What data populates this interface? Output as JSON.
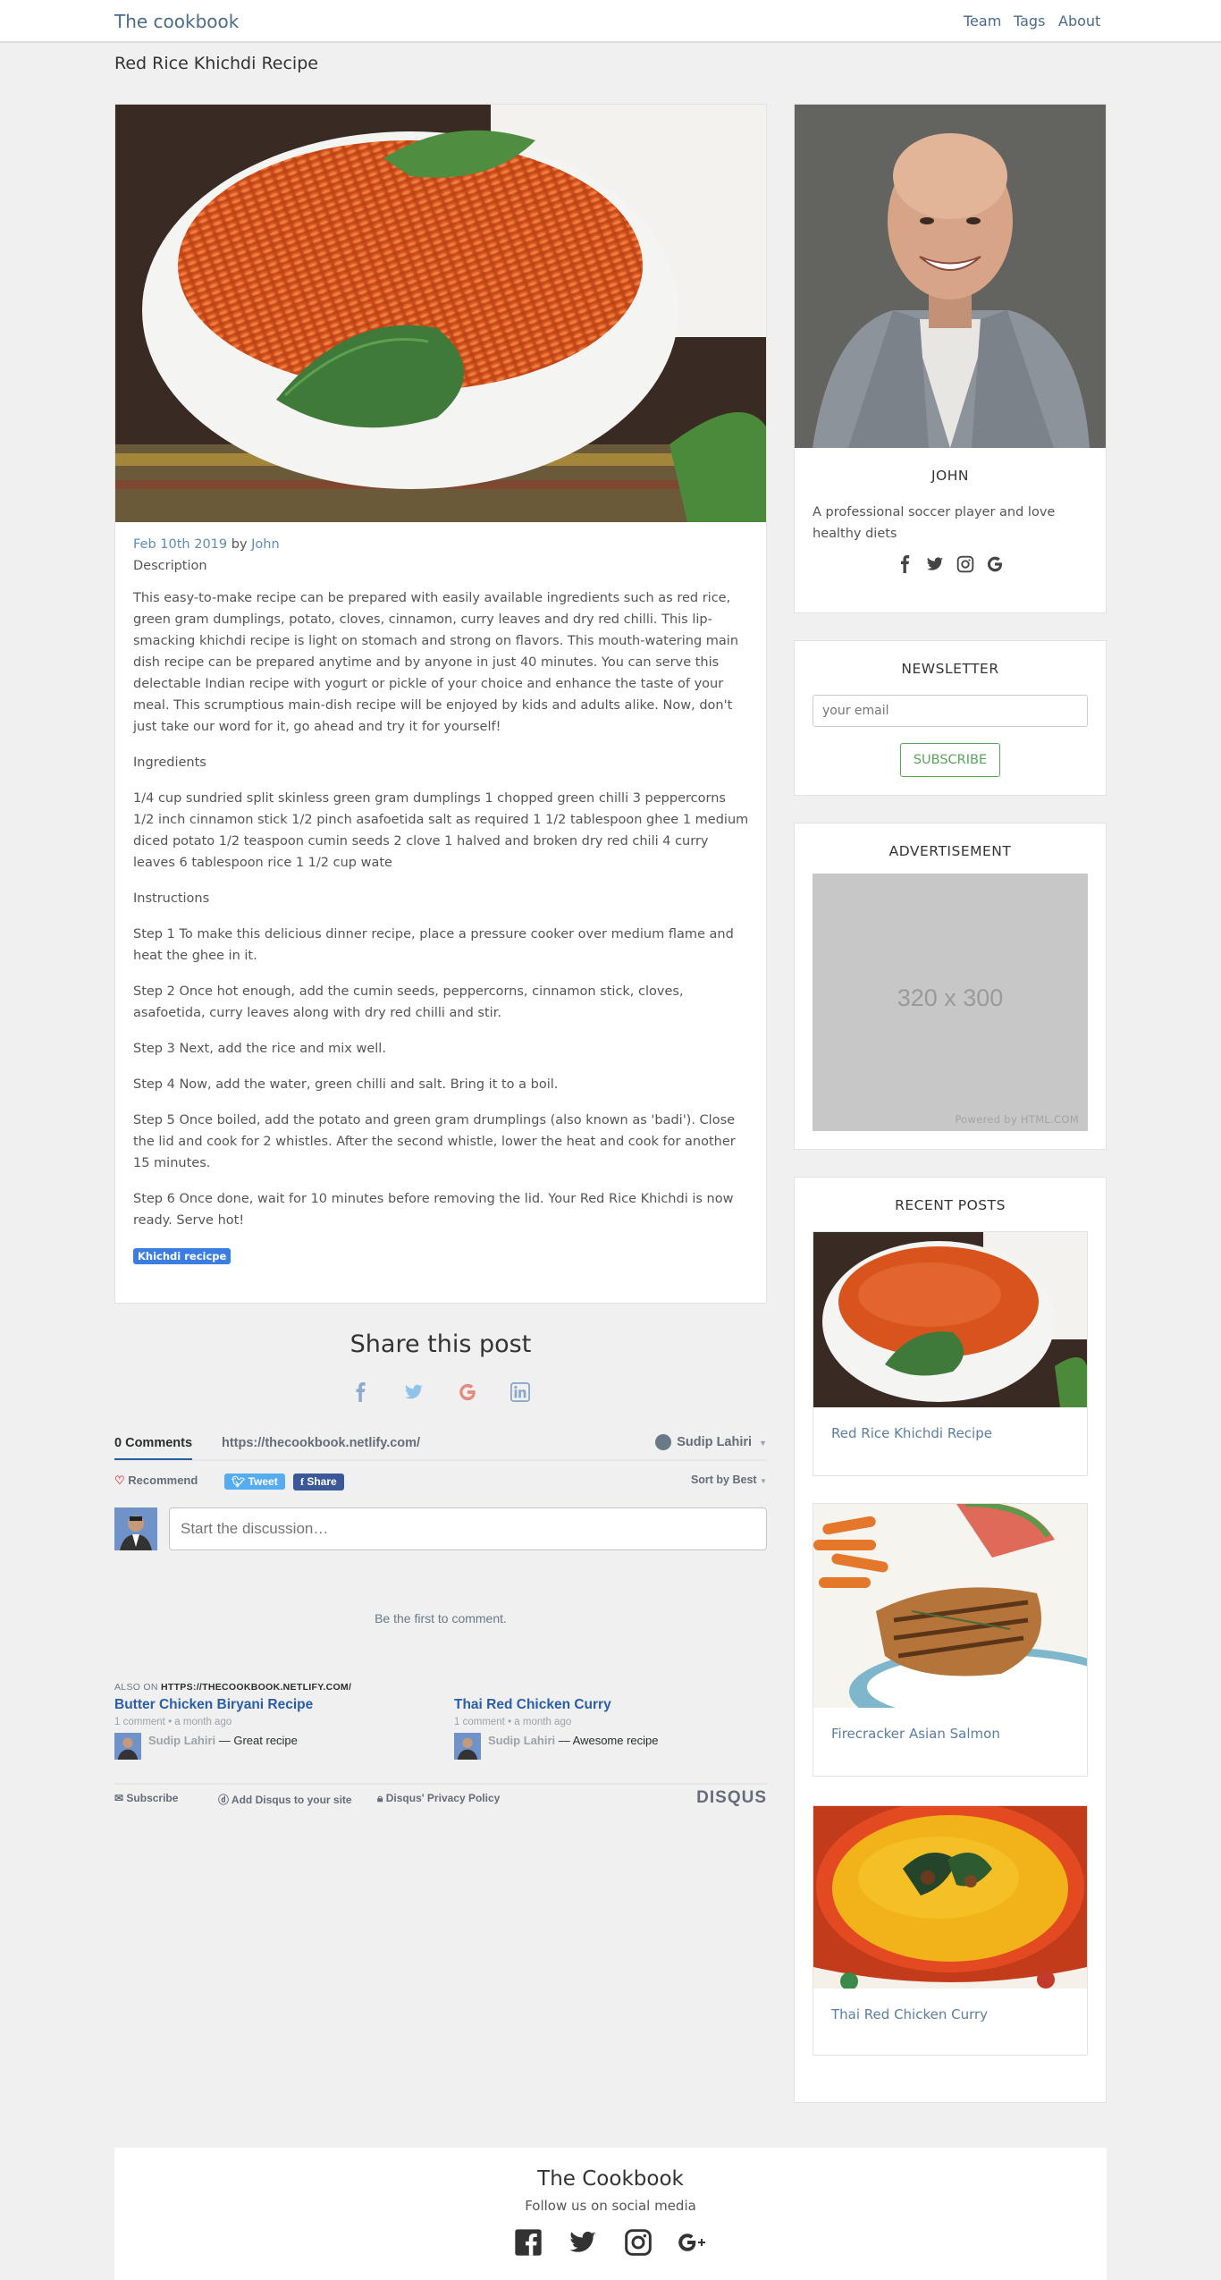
{
  "nav": {
    "brand": "The cookbook",
    "links": [
      "Team",
      "Tags",
      "About"
    ]
  },
  "page": {
    "title": "Red Rice Khichdi Recipe"
  },
  "post": {
    "date": "Feb 10th 2019",
    "by": "by",
    "author": "John",
    "description_label": "Description",
    "description": "This easy-to-make recipe can be prepared with easily available ingredients such as red rice, green gram dumplings, potato, cloves, cinnamon, curry leaves and dry red chilli. This lip-smacking khichdi recipe is light on stomach and strong on flavors. This mouth-watering main dish recipe can be prepared anytime and by anyone in just 40 minutes. You can serve this delectable Indian recipe with yogurt or pickle of your choice and enhance the taste of your meal. This scrumptious main-dish recipe will be enjoyed by kids and adults alike. Now, don't just take our word for it, go ahead and try it for yourself!",
    "ingredients_label": "Ingredients",
    "ingredients": "1/4 cup sundried split skinless green gram dumplings 1 chopped green chilli 3 peppercorns 1/2 inch cinnamon stick 1/2 pinch asafoetida salt as required 1 1/2 tablespoon ghee 1 medium diced potato 1/2 teaspoon cumin seeds 2 clove 1 halved and broken dry red chili 4 curry leaves 6 tablespoon rice 1 1/2 cup wate",
    "instructions_label": "Instructions",
    "steps": [
      "Step 1 To make this delicious dinner recipe, place a pressure cooker over medium flame and heat the ghee in it.",
      "Step 2 Once hot enough, add the cumin seeds, peppercorns, cinnamon stick, cloves, asafoetida, curry leaves along with dry red chilli and stir.",
      "Step 3 Next, add the rice and mix well.",
      "Step 4 Now, add the water, green chilli and salt. Bring it to a boil.",
      "Step 5 Once boiled, add the potato and green gram drumplings (also known as 'badi'). Close the lid and cook for 2 whistles. After the second whistle, lower the heat and cook for another 15 minutes.",
      "Step 6 Once done, wait for 10 minutes before removing the lid. Your Red Rice Khichdi is now ready. Serve hot!"
    ],
    "tag": "Khichdi recicpe"
  },
  "share": {
    "title": "Share this post",
    "icons": [
      "facebook-icon",
      "twitter-icon",
      "google-icon",
      "linkedin-icon"
    ]
  },
  "disqus": {
    "comments_tab": "0 Comments",
    "url_tab": "https://thecookbook.netlify.com/",
    "user": "Sudip Lahiri",
    "recommend": "Recommend",
    "tweet": "Tweet",
    "share": "Share",
    "sort": "Sort by Best",
    "placeholder": "Start the discussion…",
    "empty": "Be the first to comment.",
    "also_on_prefix": "ALSO ON ",
    "also_on_site": "HTTPS://THECOOKBOOK.NETLIFY.COM/",
    "related": [
      {
        "title": "Butter Chicken Biryani Recipe",
        "meta": "1 comment • a month ago",
        "author": "Sudip Lahiri",
        "comment": "— Great recipe"
      },
      {
        "title": "Thai Red Chicken Curry",
        "meta": "1 comment • a month ago",
        "author": "Sudip Lahiri",
        "comment": "— Awesome recipe"
      }
    ],
    "footer": {
      "subscribe": "Subscribe",
      "add": "Add Disqus to your site",
      "privacy": "Disqus' Privacy Policy",
      "brand": "DISQUS"
    }
  },
  "sidebar": {
    "author": {
      "name": "JOHN",
      "bio": "A professional soccer player and love healthy diets",
      "socials": [
        "facebook-icon",
        "twitter-icon",
        "instagram-icon",
        "google-icon"
      ]
    },
    "newsletter": {
      "title": "NEWSLETTER",
      "placeholder": "your email",
      "button": "SUBSCRIBE"
    },
    "ad": {
      "title": "ADVERTISEMENT",
      "size": "320 x 300",
      "powered": "Powered by HTML.COM"
    },
    "recent": {
      "title": "RECENT POSTS",
      "items": [
        "Red Rice Khichdi Recipe",
        "Firecracker Asian Salmon",
        "Thai Red Chicken Curry"
      ]
    }
  },
  "footer": {
    "title": "The Cookbook",
    "subtitle": "Follow us on social media"
  },
  "colors": {
    "link": "#5b8cb8",
    "tag": "#3b7de0",
    "subscribe": "#5aa55a",
    "disqus_blue": "#2a5ea8"
  }
}
